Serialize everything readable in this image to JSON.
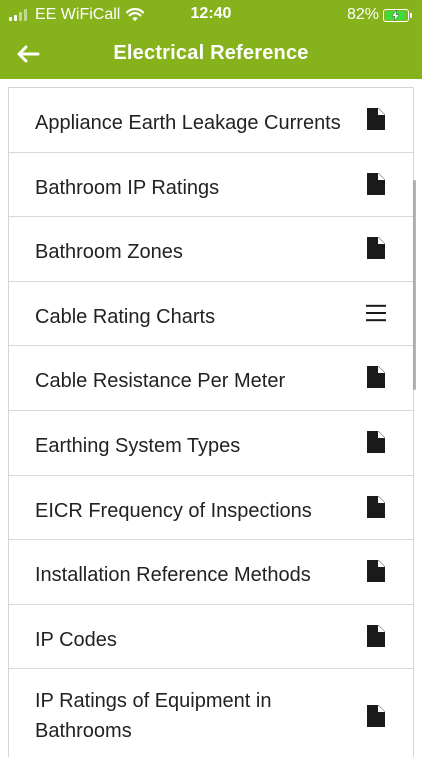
{
  "status_bar": {
    "carrier": "EE WiFiCall",
    "time": "12:40",
    "battery_percent": "82%",
    "battery_level": 0.82,
    "signal_bars_active": 2,
    "signal_bars_total": 4
  },
  "header": {
    "title": "Electrical Reference",
    "back_icon": "arrow-left-icon"
  },
  "colors": {
    "header_bg": "#86b31b",
    "battery_fill": "#3edb3a"
  },
  "list": {
    "items": [
      {
        "label": "Appliance Earth Leakage Currents",
        "icon": "document-icon"
      },
      {
        "label": "Bathroom IP Ratings",
        "icon": "document-icon"
      },
      {
        "label": "Bathroom Zones",
        "icon": "document-icon"
      },
      {
        "label": "Cable Rating Charts",
        "icon": "menu-icon"
      },
      {
        "label": "Cable Resistance Per Meter",
        "icon": "document-icon"
      },
      {
        "label": "Earthing System Types",
        "icon": "document-icon"
      },
      {
        "label": "EICR Frequency of Inspections",
        "icon": "document-icon"
      },
      {
        "label": "Installation Reference Methods",
        "icon": "document-icon"
      },
      {
        "label": "IP Codes",
        "icon": "document-icon"
      },
      {
        "label": "IP Ratings of Equipment in Bathrooms",
        "icon": "document-icon"
      }
    ]
  }
}
